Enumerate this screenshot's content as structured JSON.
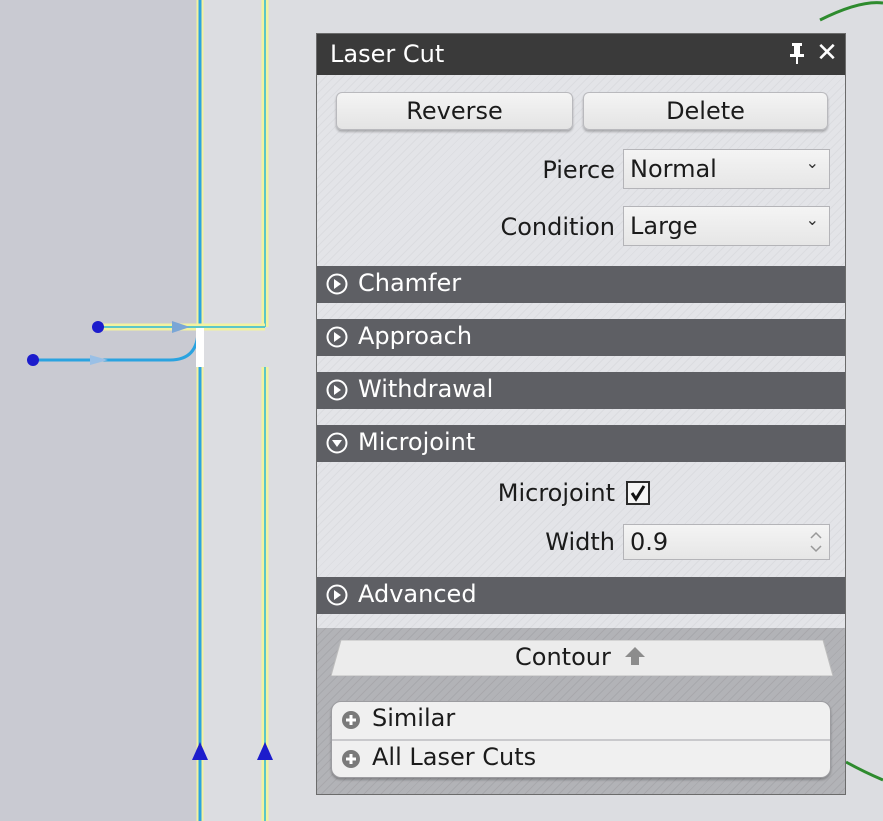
{
  "panel": {
    "title": "Laser Cut",
    "reverse_label": "Reverse",
    "delete_label": "Delete",
    "pierce": {
      "label": "Pierce",
      "value": "Normal"
    },
    "condition": {
      "label": "Condition",
      "value": "Large"
    },
    "sections": {
      "chamfer": "Chamfer",
      "approach": "Approach",
      "withdrawal": "Withdrawal",
      "microjoint": "Microjoint",
      "advanced": "Advanced"
    },
    "microjoint": {
      "checkbox_label": "Microjoint",
      "checked": true,
      "width_label": "Width",
      "width_value": "0.9"
    },
    "contour_label": "Contour",
    "scope_items": [
      "Similar",
      "All Laser Cuts"
    ]
  },
  "icons": {
    "pin": "pin-icon",
    "close": "close-icon",
    "expand": "expand-circle-icon",
    "collapse": "collapse-circle-icon",
    "dropdown": "chevron-down-icon",
    "contour": "arrow-up-icon",
    "add": "plus-circle-icon"
  },
  "colors": {
    "title_bar": "#3a3a3a",
    "section_header": "#5e5f64",
    "cut_path": "#2aa3e0",
    "highlight": "#f2f2a0",
    "lead_point": "#1c1ccc",
    "part_outline": "#2e8b2e"
  }
}
